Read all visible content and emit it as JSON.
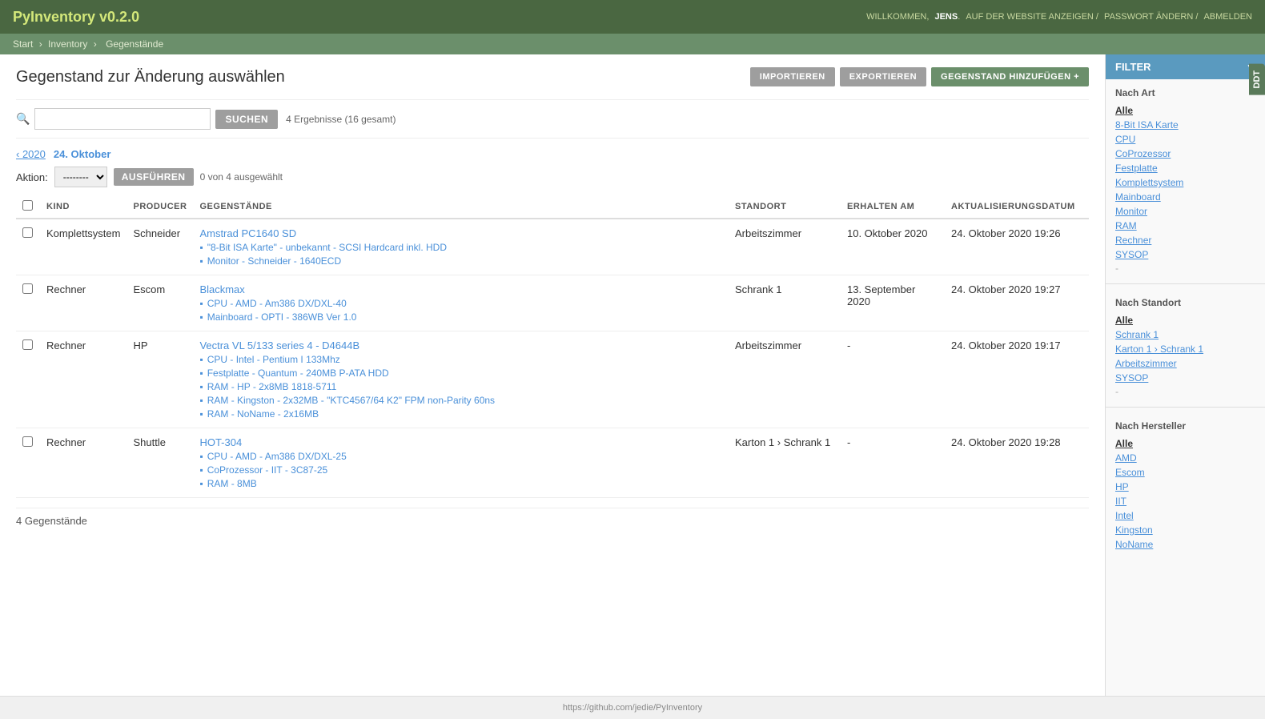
{
  "app": {
    "title": "PyInventory v0.2.0",
    "nav": {
      "welcome": "WILLKOMMEN,",
      "username": "JENS",
      "website": "AUF DER WEBSITE ANZEIGEN",
      "password": "PASSWORT ÄNDERN",
      "logout": "ABMELDEN"
    }
  },
  "breadcrumb": {
    "items": [
      "Start",
      "Inventory",
      "Gegenstände"
    ]
  },
  "page": {
    "title": "Gegenstand zur Änderung auswählen",
    "buttons": {
      "import": "IMPORTIEREN",
      "export": "EXPORTIEREN",
      "add": "GEGENSTAND HINZUFÜGEN +"
    }
  },
  "search": {
    "placeholder": "",
    "button": "Suchen",
    "results": "4 Ergebnisse (16 gesamt)"
  },
  "date_nav": {
    "prev_year": "‹ 2020",
    "current_date": "24. Oktober"
  },
  "action_bar": {
    "label": "Aktion:",
    "default_option": "--------",
    "execute": "Ausführen",
    "count": "0 von 4 ausgewählt"
  },
  "table": {
    "headers": [
      "KIND",
      "PRODUCER",
      "GEGENSTÄNDE",
      "STANDORT",
      "ERHALTEN AM",
      "AKTUALISIERUNGSDATUM"
    ],
    "rows": [
      {
        "kind": "Komplettsystem",
        "producer": "Schneider",
        "main_item": "Amstrad PC1640 SD",
        "sub_items": [
          "\"8-Bit ISA Karte\" - unbekannt - SCSI Hardcard inkl. HDD",
          "Monitor - Schneider - 1640ECD"
        ],
        "standort": "Arbeitszimmer",
        "erhalten": "10. Oktober 2020",
        "aktualisierung": "24. Oktober 2020 19:26"
      },
      {
        "kind": "Rechner",
        "producer": "Escom",
        "main_item": "Blackmax",
        "sub_items": [
          "CPU - AMD - Am386 DX/DXL-40",
          "Mainboard - OPTI - 386WB Ver 1.0"
        ],
        "standort": "Schrank 1",
        "erhalten": "13. September 2020",
        "aktualisierung": "24. Oktober 2020 19:27"
      },
      {
        "kind": "Rechner",
        "producer": "HP",
        "main_item": "Vectra VL 5/133 series 4 - D4644B",
        "sub_items": [
          "CPU - Intel - Pentium I 133Mhz",
          "Festplatte - Quantum - 240MB P-ATA HDD",
          "RAM - HP - 2x8MB 1818-5711",
          "RAM - Kingston - 2x32MB - \"KTC4567/64 K2\" FPM non-Parity 60ns",
          "RAM - NoName - 2x16MB"
        ],
        "standort": "Arbeitszimmer",
        "erhalten": "-",
        "aktualisierung": "24. Oktober 2020 19:17"
      },
      {
        "kind": "Rechner",
        "producer": "Shuttle",
        "main_item": "HOT-304",
        "sub_items": [
          "CPU - AMD - Am386 DX/DXL-25",
          "CoProzessor - IIT - 3C87-25",
          "RAM - 8MB"
        ],
        "standort": "Karton 1 › Schrank 1",
        "erhalten": "-",
        "aktualisierung": "24. Oktober 2020 19:28"
      }
    ]
  },
  "footer_count": "4 Gegenstände",
  "filter": {
    "header": "FILTER",
    "nach_art": {
      "title": "Nach Art",
      "items": [
        "Alle",
        "8-Bit ISA Karte",
        "CPU",
        "CoProzessor",
        "Festplatte",
        "Komplettsystem",
        "Mainboard",
        "Monitor",
        "RAM",
        "Rechner",
        "SYSOP"
      ]
    },
    "nach_standort": {
      "title": "Nach Standort",
      "items": [
        "Alle",
        "Schrank 1",
        "Karton 1 › Schrank 1",
        "Arbeitszimmer",
        "SYSOP"
      ]
    },
    "nach_hersteller": {
      "title": "Nach Hersteller",
      "items": [
        "Alle",
        "AMD",
        "Escom",
        "HP",
        "IIT",
        "Intel",
        "Kingston",
        "NoName"
      ]
    }
  },
  "side_tab": "DDT",
  "footer_url": "https://github.com/jedie/PyInventory"
}
